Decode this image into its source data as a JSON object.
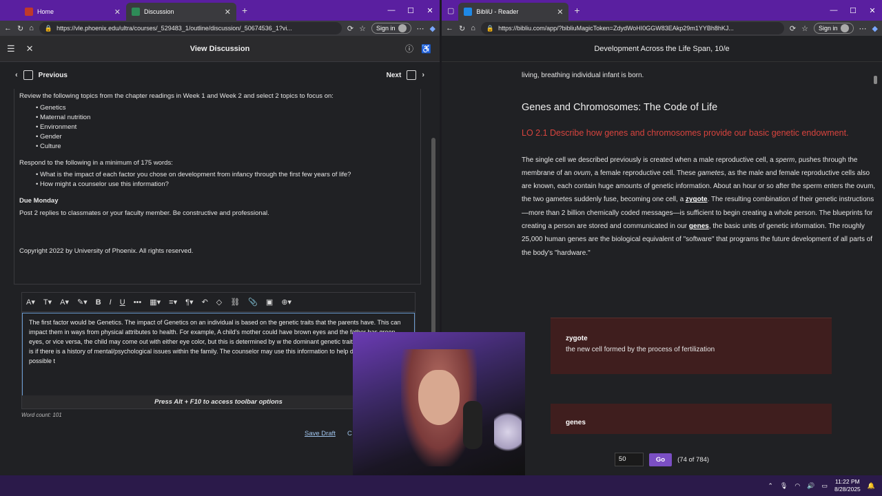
{
  "left_browser": {
    "tabs": [
      {
        "label": "Home",
        "active": false
      },
      {
        "label": "Discussion",
        "active": true
      }
    ],
    "url": "https://vle.phoenix.edu/ultra/courses/_529483_1/outline/discussion/_50674536_1?vi...",
    "signin": "Sign in"
  },
  "blackboard": {
    "title": "View Discussion",
    "previous": "Previous",
    "next": "Next",
    "intro": "Review the following topics from the chapter readings in Week 1 and Week 2 and select 2 topics to focus on:",
    "topics": [
      "Genetics",
      "Maternal nutrition",
      "Environment",
      "Gender",
      "Culture"
    ],
    "respond_intro": "Respond to the following in a minimum of 175 words:",
    "questions": [
      "What is the impact of each factor you chose on development from infancy through the first few years of life?",
      "How might a counselor use this information?"
    ],
    "due_heading": "Due Monday",
    "due_text": "Post 2 replies to classmates or your faculty member. Be constructive and professional.",
    "copyright": "Copyright 2022 by University of Phoenix. All rights reserved.",
    "editor_text": "The first factor would be Genetics. The impact of Genetics on an individual is based on the genetic traits that the parents have. This can impact them in ways from physical attributes to health.  For example, A child's mother could have brown eyes and the father has green eyes, or vice versa, the child may come out with either eye color, but this is determined by w the dominant genetic traits. Another example is if there is a history of mental/psychological issues within the family. The counselor may use this information to help deteremine with the possible t",
    "toolbar_hint": "Press Alt + F10 to access toolbar options",
    "word_count": "Word count: 101",
    "save_draft": "Save Draft",
    "submit_partial": "C"
  },
  "right_browser": {
    "tab": "BibliU - Reader",
    "url": "https://bibliu.com/app/?bibliuMagicToken=ZdydWoHI0GGW83EAkp29m1YYBh8hKJ...",
    "signin": "Sign in"
  },
  "reader": {
    "book_title": "Development Across the Life Span, 10/e",
    "top_line": "living, breathing individual infant is born.",
    "heading": "Genes and Chromosomes: The Code of Life",
    "lo": "LO 2.1   Describe how genes and chromosomes provide our basic genetic endowment.",
    "para_1": "The single cell we described previously is created when a male reproductive cell, a ",
    "sperm": "sperm",
    "para_2": ", pushes through the membrane of an ",
    "ovum": "ovum",
    "para_3": ", a female reproductive cell. These ",
    "gametes": "gametes",
    "para_4": ", as the male and female reproductive cells also are known, each contain huge amounts of genetic information. About an hour or so after the sperm enters the ovum, the two gametes suddenly fuse, becoming one cell, a ",
    "zygote_kw": "zygote",
    "para_5": ". The resulting combination of their genetic instructions—more than 2 billion chemically coded messages—is sufficient to begin creating a whole person. The blueprints for creating a person are stored and communicated in our ",
    "genes_kw": "genes",
    "para_6": ", the basic units of genetic information. The roughly 25,000 human genes are the biological equivalent of \"software\" that programs the future development of all parts of the body's \"hardware.\"",
    "glossary": [
      {
        "term": "zygote",
        "def": "the new cell formed by the process of fertilization"
      },
      {
        "term": "genes",
        "def": ""
      }
    ],
    "page_input": "50",
    "go": "Go",
    "page_info": "(74 of 784)"
  },
  "taskbar": {
    "time": "11:22 PM",
    "date": "8/28/2025"
  }
}
